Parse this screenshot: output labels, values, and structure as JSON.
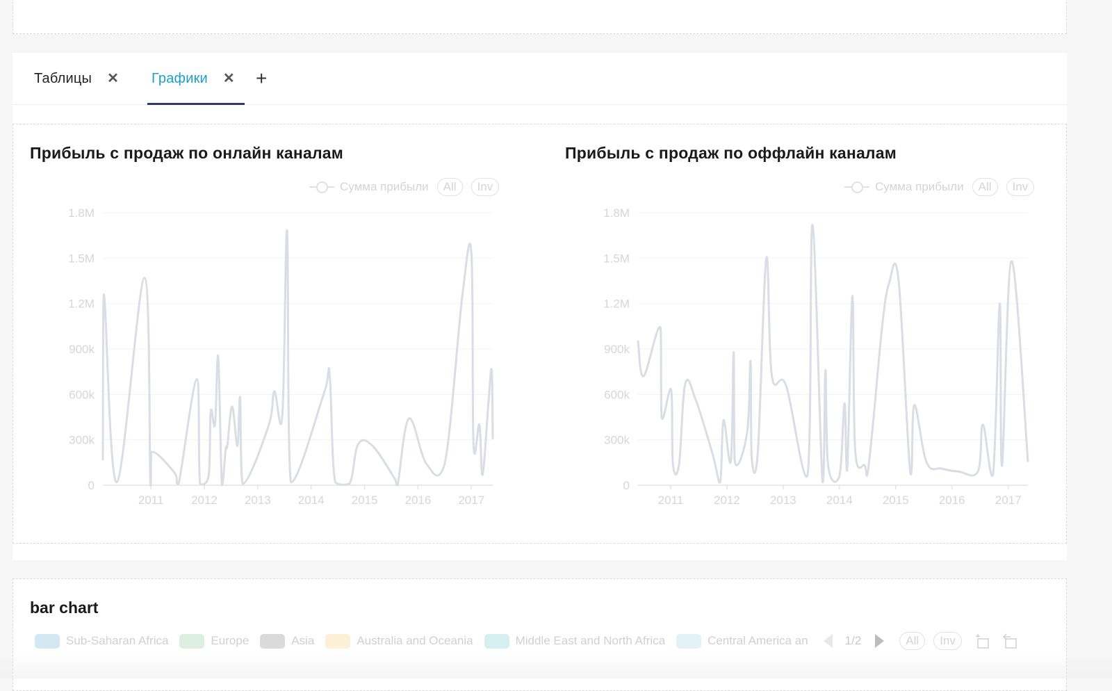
{
  "tabs": {
    "items": [
      {
        "label": "Таблицы",
        "active": false
      },
      {
        "label": "Графики",
        "active": true
      }
    ],
    "close_glyph": "✕",
    "add_glyph": "+"
  },
  "colors": {
    "active_tab_text": "#1c9fcb",
    "active_tab_underline": "#2c3a6e",
    "line": "#dadce6",
    "axis_text": "#d6d6d6"
  },
  "chart_data": [
    {
      "type": "line",
      "title": "Прибыль с продаж по онлайн каналам",
      "legend": {
        "label": "Сумма прибыли",
        "all_label": "All",
        "inv_label": "Inv",
        "placement": "top-right"
      },
      "xlabel": "",
      "ylabel": "",
      "xlim": [
        2010.1,
        2017.4
      ],
      "ylim": [
        0,
        1800000
      ],
      "yticks": [
        {
          "value": 0,
          "label": "0"
        },
        {
          "value": 300000,
          "label": "300k"
        },
        {
          "value": 600000,
          "label": "600k"
        },
        {
          "value": 900000,
          "label": "900k"
        },
        {
          "value": 1200000,
          "label": "1.2M"
        },
        {
          "value": 1500000,
          "label": "1.5M"
        },
        {
          "value": 1800000,
          "label": "1.8M"
        }
      ],
      "xticks": [
        {
          "value": 2011,
          "label": "2011"
        },
        {
          "value": 2012,
          "label": "2012"
        },
        {
          "value": 2013,
          "label": "2013"
        },
        {
          "value": 2014,
          "label": "2014"
        },
        {
          "value": 2015,
          "label": "2015"
        },
        {
          "value": 2016,
          "label": "2016"
        },
        {
          "value": 2017,
          "label": "2017"
        }
      ],
      "grid": true,
      "series": [
        {
          "name": "Сумма прибыли",
          "points": [
            [
              2010.1,
              170000
            ],
            [
              2010.12,
              1260000
            ],
            [
              2010.36,
              20000
            ],
            [
              2010.88,
              1370000
            ],
            [
              2010.99,
              0
            ],
            [
              2011.01,
              220000
            ],
            [
              2011.45,
              80000
            ],
            [
              2011.52,
              10000
            ],
            [
              2011.86,
              700000
            ],
            [
              2011.92,
              10000
            ],
            [
              2012.08,
              60000
            ],
            [
              2012.12,
              490000
            ],
            [
              2012.2,
              400000
            ],
            [
              2012.26,
              850000
            ],
            [
              2012.33,
              0
            ],
            [
              2012.4,
              240000
            ],
            [
              2012.43,
              260000
            ],
            [
              2012.52,
              520000
            ],
            [
              2012.62,
              260000
            ],
            [
              2012.67,
              580000
            ],
            [
              2012.72,
              10000
            ],
            [
              2013.2,
              390000
            ],
            [
              2013.31,
              620000
            ],
            [
              2013.46,
              460000
            ],
            [
              2013.55,
              1680000
            ],
            [
              2013.62,
              20000
            ],
            [
              2014.28,
              650000
            ],
            [
              2014.35,
              710000
            ],
            [
              2014.45,
              20000
            ],
            [
              2014.72,
              10000
            ],
            [
              2014.88,
              270000
            ],
            [
              2015.15,
              260000
            ],
            [
              2015.57,
              40000
            ],
            [
              2015.62,
              0
            ],
            [
              2015.83,
              440000
            ],
            [
              2016.16,
              140000
            ],
            [
              2016.5,
              140000
            ],
            [
              2016.83,
              1250000
            ],
            [
              2017.0,
              1530000
            ],
            [
              2017.04,
              270000
            ],
            [
              2017.15,
              400000
            ],
            [
              2017.21,
              70000
            ],
            [
              2017.32,
              550000
            ],
            [
              2017.38,
              760000
            ],
            [
              2017.4,
              310000
            ]
          ]
        }
      ]
    },
    {
      "type": "line",
      "title": "Прибыль с продаж по оффлайн каналам",
      "legend": {
        "label": "Сумма прибыли",
        "all_label": "All",
        "inv_label": "Inv",
        "placement": "top-right"
      },
      "xlabel": "",
      "ylabel": "",
      "xlim": [
        2010.42,
        2017.35
      ],
      "ylim": [
        0,
        1800000
      ],
      "yticks": [
        {
          "value": 0,
          "label": "0"
        },
        {
          "value": 300000,
          "label": "300k"
        },
        {
          "value": 600000,
          "label": "600k"
        },
        {
          "value": 900000,
          "label": "900k"
        },
        {
          "value": 1200000,
          "label": "1.2M"
        },
        {
          "value": 1500000,
          "label": "1.5M"
        },
        {
          "value": 1800000,
          "label": "1.8M"
        }
      ],
      "xticks": [
        {
          "value": 2011,
          "label": "2011"
        },
        {
          "value": 2012,
          "label": "2012"
        },
        {
          "value": 2013,
          "label": "2013"
        },
        {
          "value": 2014,
          "label": "2014"
        },
        {
          "value": 2015,
          "label": "2015"
        },
        {
          "value": 2016,
          "label": "2016"
        },
        {
          "value": 2017,
          "label": "2017"
        }
      ],
      "grid": true,
      "series": [
        {
          "name": "Сумма прибыли",
          "points": [
            [
              2010.42,
              950000
            ],
            [
              2010.52,
              720000
            ],
            [
              2010.82,
              1040000
            ],
            [
              2010.84,
              450000
            ],
            [
              2011.01,
              630000
            ],
            [
              2011.04,
              140000
            ],
            [
              2011.15,
              140000
            ],
            [
              2011.26,
              670000
            ],
            [
              2011.45,
              560000
            ],
            [
              2011.75,
              200000
            ],
            [
              2011.88,
              20000
            ],
            [
              2011.94,
              430000
            ],
            [
              2012.07,
              160000
            ],
            [
              2012.12,
              880000
            ],
            [
              2012.14,
              160000
            ],
            [
              2012.36,
              350000
            ],
            [
              2012.42,
              820000
            ],
            [
              2012.44,
              190000
            ],
            [
              2012.55,
              220000
            ],
            [
              2012.7,
              1500000
            ],
            [
              2012.8,
              720000
            ],
            [
              2013.05,
              660000
            ],
            [
              2013.43,
              60000
            ],
            [
              2013.52,
              1720000
            ],
            [
              2013.7,
              20000
            ],
            [
              2013.75,
              760000
            ],
            [
              2013.8,
              130000
            ],
            [
              2014.0,
              60000
            ],
            [
              2014.09,
              540000
            ],
            [
              2014.14,
              110000
            ],
            [
              2014.23,
              1250000
            ],
            [
              2014.28,
              230000
            ],
            [
              2014.45,
              130000
            ],
            [
              2014.5,
              80000
            ],
            [
              2014.6,
              420000
            ],
            [
              2014.76,
              1050000
            ],
            [
              2014.88,
              1330000
            ],
            [
              2015.05,
              1360000
            ],
            [
              2015.26,
              80000
            ],
            [
              2015.33,
              530000
            ],
            [
              2015.55,
              150000
            ],
            [
              2015.82,
              110000
            ],
            [
              2016.12,
              90000
            ],
            [
              2016.46,
              90000
            ],
            [
              2016.55,
              400000
            ],
            [
              2016.73,
              70000
            ],
            [
              2016.85,
              1200000
            ],
            [
              2016.89,
              130000
            ],
            [
              2017.06,
              1480000
            ],
            [
              2017.35,
              160000
            ]
          ]
        }
      ]
    },
    {
      "type": "bar",
      "title": "bar chart",
      "legend": {
        "placement": "top",
        "entries": [
          {
            "label": "Sub-Saharan Africa",
            "color": "#d3e8f3"
          },
          {
            "label": "Europe",
            "color": "#dcefe1"
          },
          {
            "label": "Asia",
            "color": "#dadada"
          },
          {
            "label": "Australia and Oceania",
            "color": "#fcf0d6"
          },
          {
            "label": "Middle East and North Africa",
            "color": "#d6eff1"
          },
          {
            "label": "Central America an",
            "color": "#e3f2f6"
          }
        ],
        "pager": "1/2",
        "all_label": "All",
        "inv_label": "Inv"
      }
    }
  ]
}
